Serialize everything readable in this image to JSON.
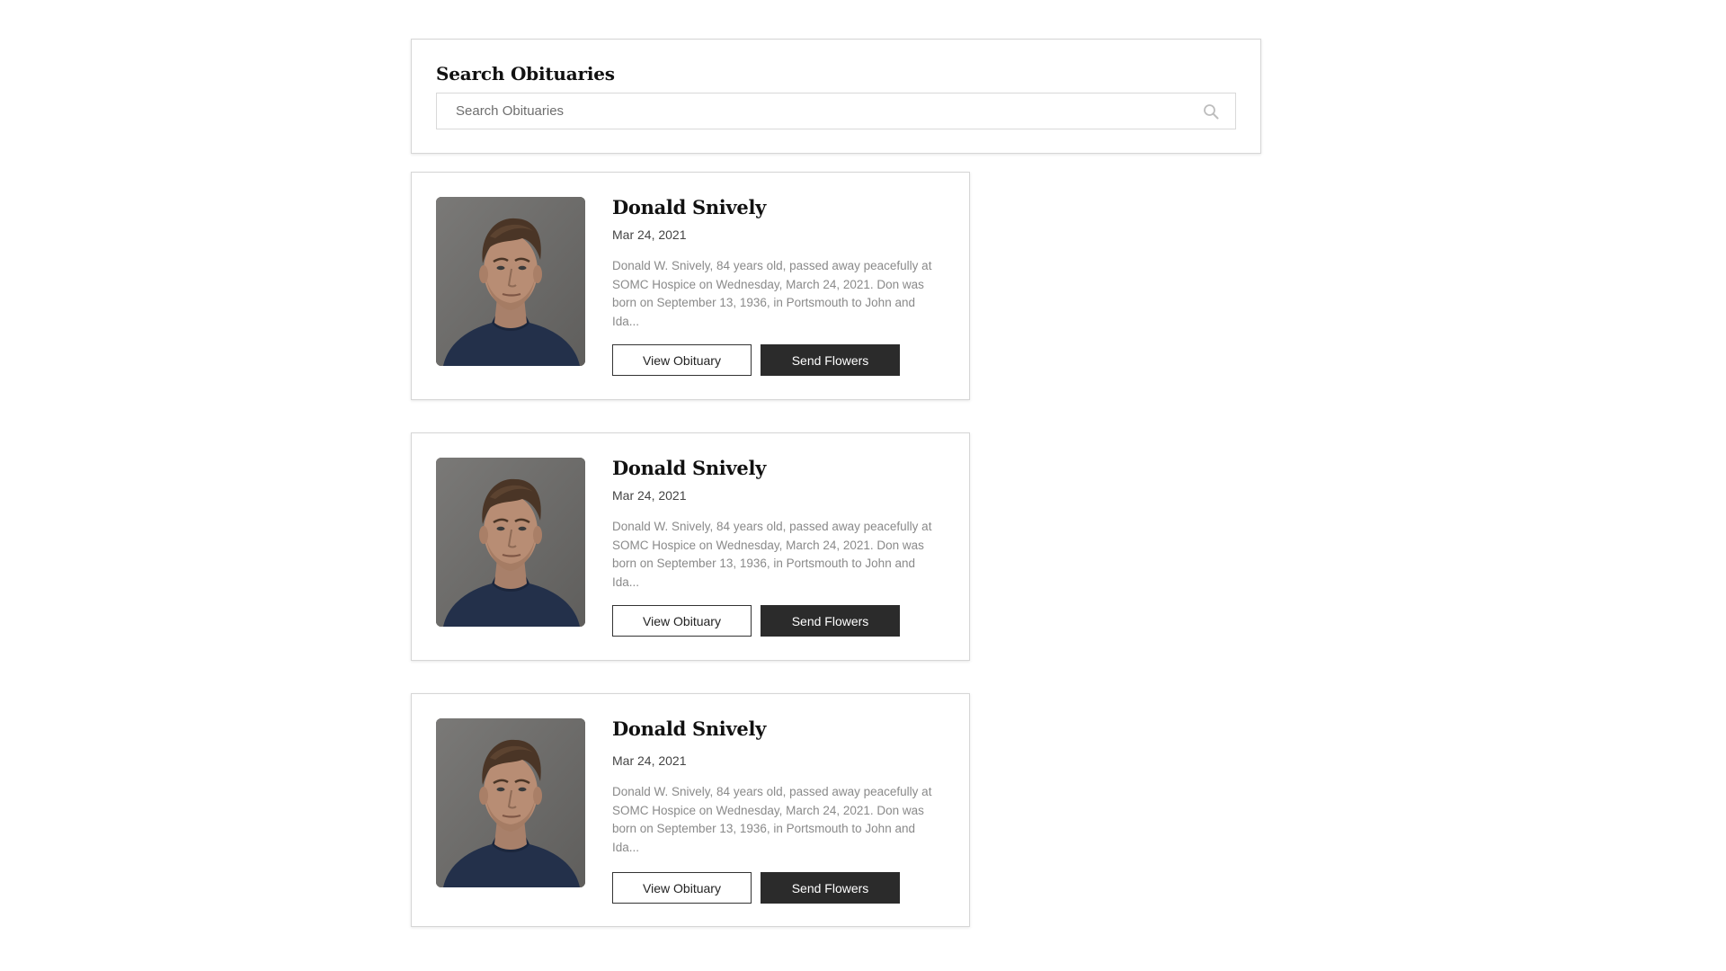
{
  "search": {
    "title": "Search Obituaries",
    "placeholder": "Search Obituaries",
    "icon": "search-icon"
  },
  "obituaries": [
    {
      "name": "Donald Snively",
      "date": "Mar 24, 2021",
      "summary": "Donald W. Snively, 84 years old, passed away peacefully at SOMC Hospice on Wednesday, March 24, 2021. Don was born on September 13, 1936, in Portsmouth to John and Ida...",
      "view_label": "View Obituary",
      "flowers_label": "Send Flowers"
    },
    {
      "name": "Donald Snively",
      "date": "Mar 24, 2021",
      "summary": "Donald W. Snively, 84 years old, passed away peacefully at SOMC Hospice on Wednesday, March 24, 2021. Don was born on September 13, 1936, in Portsmouth to John and Ida...",
      "view_label": "View Obituary",
      "flowers_label": "Send Flowers"
    },
    {
      "name": "Donald Snively",
      "date": "Mar 24, 2021",
      "summary": "Donald W. Snively, 84 years old, passed away peacefully at SOMC Hospice on Wednesday, March 24, 2021. Don was born on September 13, 1936, in Portsmouth to John and Ida...",
      "view_label": "View Obituary",
      "flowers_label": "Send Flowers"
    }
  ],
  "colors": {
    "button_dark": "#2b2b2b",
    "summary_text": "#8a8a8a",
    "border": "#d6d6d6"
  }
}
